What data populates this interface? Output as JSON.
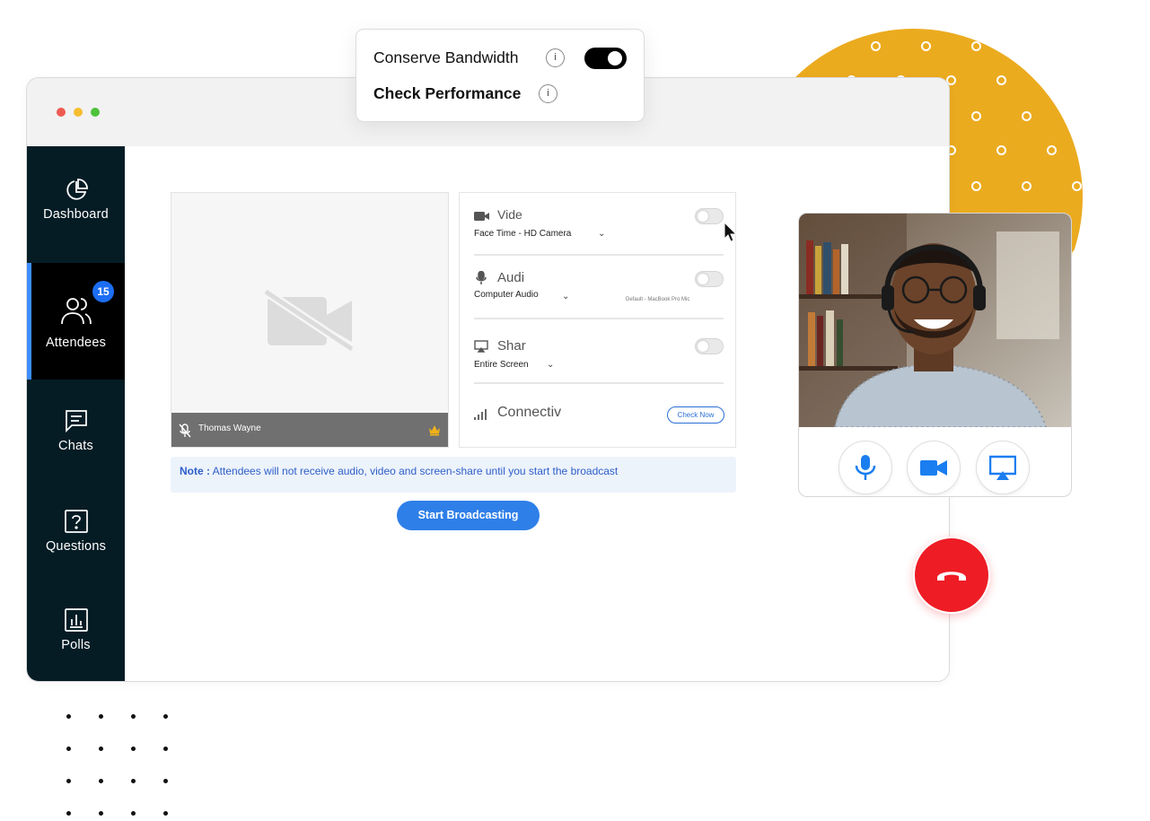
{
  "popup": {
    "conserve_bandwidth_label": "Conserve Bandwidth",
    "conserve_bandwidth_on": true,
    "check_performance_label": "Check Performance",
    "info_glyph": "i"
  },
  "sidebar": {
    "items": [
      {
        "label": "Dashboard",
        "icon": "pie-chart-icon"
      },
      {
        "label": "Attendees",
        "icon": "users-icon",
        "badge": "15",
        "active": true
      },
      {
        "label": "Chats",
        "icon": "chat-icon"
      },
      {
        "label": "Questions",
        "icon": "question-icon"
      },
      {
        "label": "Polls",
        "icon": "poll-icon"
      }
    ]
  },
  "preview": {
    "name": "Thomas Wayne",
    "icon": "video-off-icon"
  },
  "settings": {
    "video": {
      "title": "Vide",
      "device": "Face Time - HD Camera",
      "enabled": false
    },
    "audio": {
      "title": "Audi",
      "device": "Computer Audio",
      "sub_device": "Default - MacBook Pro Mic",
      "enabled": false
    },
    "share": {
      "title": "Shar",
      "device": "Entire Screen",
      "enabled": false
    },
    "connectivity": {
      "title": "Connectiv",
      "button": "Check Now"
    }
  },
  "note": {
    "prefix": "Note :",
    "text": "Attendees will not receive audio, video and screen-share until you start the broadcast"
  },
  "broadcast_button": "Start Broadcasting",
  "colors": {
    "accent": "#2e7fe8",
    "sidebar_bg": "#051c25",
    "end_call": "#ee1c25",
    "decor_yellow": "#ebab1f",
    "badge": "#1c6df2"
  }
}
